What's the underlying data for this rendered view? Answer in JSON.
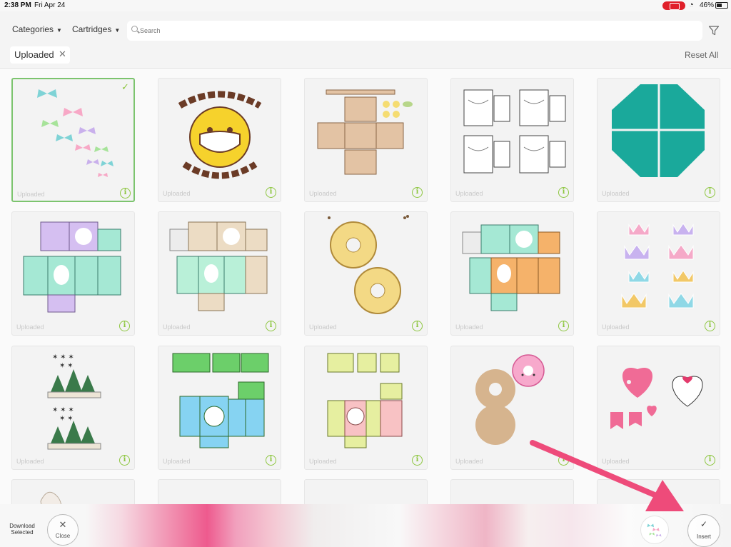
{
  "status_bar": {
    "time": "2:38 PM",
    "date": "Fri Apr 24",
    "battery": "46%"
  },
  "toolbar": {
    "categories_label": "Categories",
    "cartridges_label": "Cartridges",
    "search_placeholder": "Search",
    "filter_chip": "Uploaded",
    "reset_label": "Reset All"
  },
  "tiles": [
    {
      "label": "Uploaded",
      "selected": true,
      "art": "butterflies"
    },
    {
      "label": "Uploaded",
      "selected": false,
      "art": "dont-worry-emoji"
    },
    {
      "label": "Uploaded",
      "selected": false,
      "art": "tan-box-template"
    },
    {
      "label": "Uploaded",
      "selected": false,
      "art": "coloring-tags"
    },
    {
      "label": "Uploaded",
      "selected": false,
      "art": "teal-octagon"
    },
    {
      "label": "Uploaded",
      "selected": false,
      "art": "purple-mint-box"
    },
    {
      "label": "Uploaded",
      "selected": false,
      "art": "tan-mint-box"
    },
    {
      "label": "Uploaded",
      "selected": false,
      "art": "donuts"
    },
    {
      "label": "Uploaded",
      "selected": false,
      "art": "teal-orange-box"
    },
    {
      "label": "Uploaded",
      "selected": false,
      "art": "crowns"
    },
    {
      "label": "Uploaded",
      "selected": false,
      "art": "christmas-trees"
    },
    {
      "label": "Uploaded",
      "selected": false,
      "art": "green-blue-box"
    },
    {
      "label": "Uploaded",
      "selected": false,
      "art": "yellow-pink-box"
    },
    {
      "label": "Uploaded",
      "selected": false,
      "art": "donut-layers"
    },
    {
      "label": "Uploaded",
      "selected": false,
      "art": "valentine-hearts"
    }
  ],
  "bottom_bar": {
    "download_selected": "Download Selected",
    "close_label": "Close",
    "insert_label": "Insert"
  },
  "colors": {
    "accent_green": "#8dc63f",
    "selected_border": "#7cc46e",
    "arrow": "#ee4b7a"
  }
}
